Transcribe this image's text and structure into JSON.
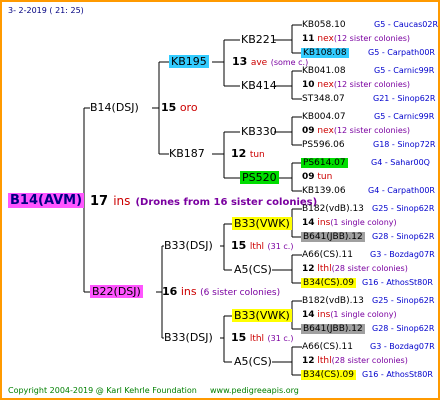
{
  "header": "3- 2-2019 ( 21: 25)",
  "footer": {
    "copyright": "Copyright 2004-2019 @ Karl Kehrle Foundation",
    "site": "www.pedigreeapis.org"
  },
  "colors": {
    "frame": "#ff9a00",
    "line": "#000000",
    "cyan": "#33ccff",
    "green": "#00dd00",
    "yellow": "#ffff00",
    "magenta": "#ff55ff",
    "grey": "#a0a0a0"
  },
  "root": {
    "label": "B14(AVM)",
    "gen": "17",
    "code": "ins",
    "note": "(Drones from 16 sister colonies)"
  },
  "sire": {
    "label": "B14(DSJ)",
    "gen": "15",
    "code": "oro"
  },
  "dam": {
    "label": "B22(DSJ)",
    "gen": "16",
    "code": "ins",
    "note": "(6 sister colonies)"
  },
  "sire_sire": {
    "label": "KB195",
    "gen": "13",
    "code": "ave",
    "note": "(some c.)"
  },
  "sire_dam": {
    "label": "KB187",
    "gen": "12",
    "code": "tun"
  },
  "dam_sire": {
    "label": "B33(DSJ)",
    "gen": "15",
    "code": "lthl",
    "note": "(31 c.)"
  },
  "dam_dam": {
    "label": "B33(DSJ)",
    "gen": "15",
    "code": "lthl",
    "note": "(31 c.)"
  },
  "g3": {
    "kb221": "KB221",
    "kb414": "KB414",
    "kb330": "KB330",
    "ps520": "PS520",
    "b33vwk_a": "B33(VWK)",
    "a5cs_a": "A5(CS)",
    "b33vwk_b": "B33(VWK)",
    "a5cs_b": "A5(CS)"
  },
  "g4": {
    "kb221": {
      "gen": "11",
      "code": "nex",
      "note": "(12 sister colonies)"
    },
    "kb414": {
      "gen": "10",
      "code": "nex",
      "note": "(12 sister colonies)"
    },
    "kb330": {
      "gen": "09",
      "code": "nex",
      "note": "(12 sister colonies)"
    },
    "ps520": {
      "gen": "09",
      "code": "tun",
      "note": ""
    },
    "b33vwk_a": {
      "gen": "14",
      "code": "ins",
      "note": "(1 single colony)"
    },
    "a5cs_a": {
      "gen": "12",
      "code": "lthl",
      "note": "(28 sister colonies)"
    },
    "b33vwk_b": {
      "gen": "14",
      "code": "ins",
      "note": "(1 single colony)"
    },
    "a5cs_b": {
      "gen": "12",
      "code": "lthl",
      "note": "(28 sister colonies)"
    }
  },
  "leaves": {
    "l1": {
      "label": "KB058.10",
      "right": "G5 - Caucas02R"
    },
    "l2": {
      "label": "KB108.08",
      "right": "G5 - Carpath00R"
    },
    "l3": {
      "label": "KB041.08",
      "right": "G5 - Carnic99R"
    },
    "l4": {
      "label": "ST348.07",
      "right": "G21 - Sinop62R"
    },
    "l5": {
      "label": "KB004.07",
      "right": "G5 - Carnic99R"
    },
    "l6": {
      "label": "PS596.06",
      "right": "G18 - Sinop72R"
    },
    "l7": {
      "label": "PS614.07",
      "right": "G4 - Sahar00Q"
    },
    "l8": {
      "label": "KB139.06",
      "right": "G4 - Carpath00R"
    },
    "l9": {
      "label": "B182(vdB).13",
      "right": "G25 - Sinop62R"
    },
    "l10": {
      "label": "B641(JBB).12",
      "right": "G28 - Sinop62R"
    },
    "l11": {
      "label": "A66(CS).11",
      "right": "G3 - Bozdag07R"
    },
    "l12": {
      "label": "B34(CS).09",
      "right": "G16 - AthosSt80R"
    },
    "l13": {
      "label": "B182(vdB).13",
      "right": "G25 - Sinop62R"
    },
    "l14": {
      "label": "B641(JBB).12",
      "right": "G28 - Sinop62R"
    },
    "l15": {
      "label": "A66(CS).11",
      "right": "G3 - Bozdag07R"
    },
    "l16": {
      "label": "B34(CS).09",
      "right": "G16 - AthosSt80R"
    }
  }
}
